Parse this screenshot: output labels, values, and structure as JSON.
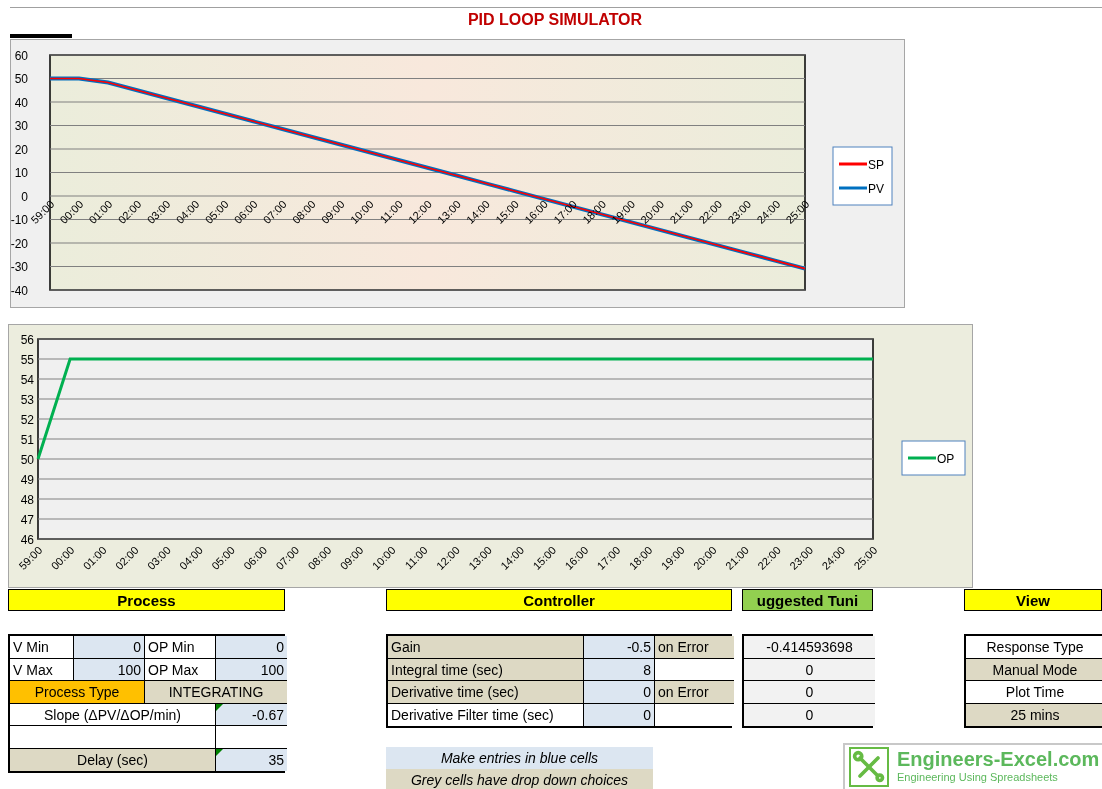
{
  "title": "PID LOOP SIMULATOR",
  "charts": [
    {
      "chart_data": {
        "type": "line",
        "grid": true,
        "legend": "right",
        "categories": [
          "59:00",
          "00:00",
          "01:00",
          "02:00",
          "03:00",
          "04:00",
          "05:00",
          "06:00",
          "07:00",
          "08:00",
          "09:00",
          "10:00",
          "11:00",
          "12:00",
          "13:00",
          "14:00",
          "15:00",
          "16:00",
          "17:00",
          "18:00",
          "19:00",
          "20:00",
          "21:00",
          "22:00",
          "23:00",
          "24:00",
          "25:00"
        ],
        "ylim": [
          -40,
          60
        ],
        "yticks": [
          -40,
          -30,
          -20,
          -10,
          0,
          10,
          20,
          30,
          40,
          50,
          60
        ],
        "series": [
          {
            "name": "SP",
            "color": "#ff0000",
            "values": [
              50,
              50,
              48.3,
              45,
              41.7,
              38.4,
              35.1,
              31.8,
              28.5,
              25.2,
              21.9,
              18.6,
              15.3,
              12,
              8.7,
              5.4,
              2.1,
              -1.2,
              -4.5,
              -7.8,
              -11.1,
              -14.4,
              -17.7,
              -21,
              -24.3,
              -27.6,
              -30.9
            ]
          },
          {
            "name": "PV",
            "color": "#0070c0",
            "values": [
              50,
              50,
              48.3,
              45,
              41.7,
              38.4,
              35.1,
              31.8,
              28.5,
              25.2,
              21.9,
              18.6,
              15.3,
              12,
              8.7,
              5.4,
              2.1,
              -1.2,
              -4.5,
              -7.8,
              -11.1,
              -14.4,
              -17.7,
              -21,
              -24.3,
              -27.6,
              -30.9
            ]
          }
        ]
      }
    },
    {
      "chart_data": {
        "type": "line",
        "grid": true,
        "legend": "right",
        "categories": [
          "59:00",
          "00:00",
          "01:00",
          "02:00",
          "03:00",
          "04:00",
          "05:00",
          "06:00",
          "07:00",
          "08:00",
          "09:00",
          "10:00",
          "11:00",
          "12:00",
          "13:00",
          "14:00",
          "15:00",
          "16:00",
          "17:00",
          "18:00",
          "19:00",
          "20:00",
          "21:00",
          "22:00",
          "23:00",
          "24:00",
          "25:00"
        ],
        "ylim": [
          46,
          56
        ],
        "yticks": [
          46,
          47,
          48,
          49,
          50,
          51,
          52,
          53,
          54,
          55,
          56
        ],
        "series": [
          {
            "name": "OP",
            "color": "#00b050",
            "values": [
              50,
              55,
              55,
              55,
              55,
              55,
              55,
              55,
              55,
              55,
              55,
              55,
              55,
              55,
              55,
              55,
              55,
              55,
              55,
              55,
              55,
              55,
              55,
              55,
              55,
              55,
              55
            ]
          }
        ]
      }
    }
  ],
  "sections": [
    {
      "header": "Process",
      "color": "#ffff00",
      "rows": [
        {
          "cells": [
            {
              "text": "V Min",
              "kind": "label"
            },
            {
              "text": "0",
              "kind": "input"
            },
            {
              "text": "OP Min",
              "kind": "label"
            },
            {
              "text": "0",
              "kind": "input"
            }
          ]
        },
        {
          "cells": [
            {
              "text": "V Max",
              "kind": "label"
            },
            {
              "text": "100",
              "kind": "input"
            },
            {
              "text": "OP Max",
              "kind": "label"
            },
            {
              "text": "100",
              "kind": "input"
            }
          ]
        },
        {
          "cells": [
            {
              "text": "Process Type",
              "kind": "highlight"
            },
            {
              "text": "INTEGRATING",
              "kind": "choice"
            }
          ]
        },
        {
          "cells": [
            {
              "text": "Slope (ΔPV/ΔOP/min)",
              "kind": "label"
            },
            {
              "text": "-0.67",
              "kind": "input",
              "marker": true
            }
          ]
        },
        {
          "cells": [
            {
              "kind": "blank"
            },
            {
              "kind": "blank"
            }
          ]
        },
        {
          "cells": [
            {
              "text": "Delay (sec)",
              "kind": "choice"
            },
            {
              "text": "35",
              "kind": "input",
              "marker": true
            }
          ]
        }
      ]
    },
    {
      "header": "Controller",
      "color": "#ffff00",
      "rows": [
        {
          "cells": [
            {
              "text": "Gain",
              "kind": "choice"
            },
            {
              "text": "-0.5",
              "kind": "input"
            },
            {
              "text": "on Error",
              "kind": "choice"
            }
          ]
        },
        {
          "cells": [
            {
              "text": "Integral time (sec)",
              "kind": "choice"
            },
            {
              "text": "8",
              "kind": "input"
            },
            {
              "kind": "blank"
            }
          ]
        },
        {
          "cells": [
            {
              "text": "Derivative time (sec)",
              "kind": "choice"
            },
            {
              "text": "0",
              "kind": "input"
            },
            {
              "text": "on Error",
              "kind": "choice"
            }
          ]
        },
        {
          "cells": [
            {
              "text": "Derivative Filter time (sec)",
              "kind": "label"
            },
            {
              "text": "0",
              "kind": "input"
            },
            {
              "kind": "blank"
            }
          ]
        }
      ]
    },
    {
      "header": "uggested Tuni",
      "color": "#92d050",
      "rows": [
        {
          "cells": [
            {
              "text": "-0.414593698",
              "kind": "output"
            }
          ]
        },
        {
          "cells": [
            {
              "text": "0",
              "kind": "output"
            }
          ]
        },
        {
          "cells": [
            {
              "text": "0",
              "kind": "output"
            }
          ]
        },
        {
          "cells": [
            {
              "text": "0",
              "kind": "output"
            }
          ]
        }
      ]
    },
    {
      "header": "View",
      "color": "#ffff00",
      "rows": [
        {
          "cells": [
            {
              "text": "Response Type",
              "kind": "label"
            }
          ]
        },
        {
          "cells": [
            {
              "text": "Manual Mode",
              "kind": "choice"
            }
          ]
        },
        {
          "cells": [
            {
              "text": "Plot Time",
              "kind": "label"
            }
          ]
        },
        {
          "cells": [
            {
              "text": "25 mins",
              "kind": "choice"
            }
          ]
        }
      ]
    }
  ],
  "notes": [
    {
      "text": "Make entries in blue cells",
      "kind": "input"
    },
    {
      "text": "Grey cells have drop down choices",
      "kind": "choice"
    }
  ],
  "logo": {
    "title": "Engineers-Excel.com",
    "tagline": "Engineering Using Spreadsheets"
  }
}
